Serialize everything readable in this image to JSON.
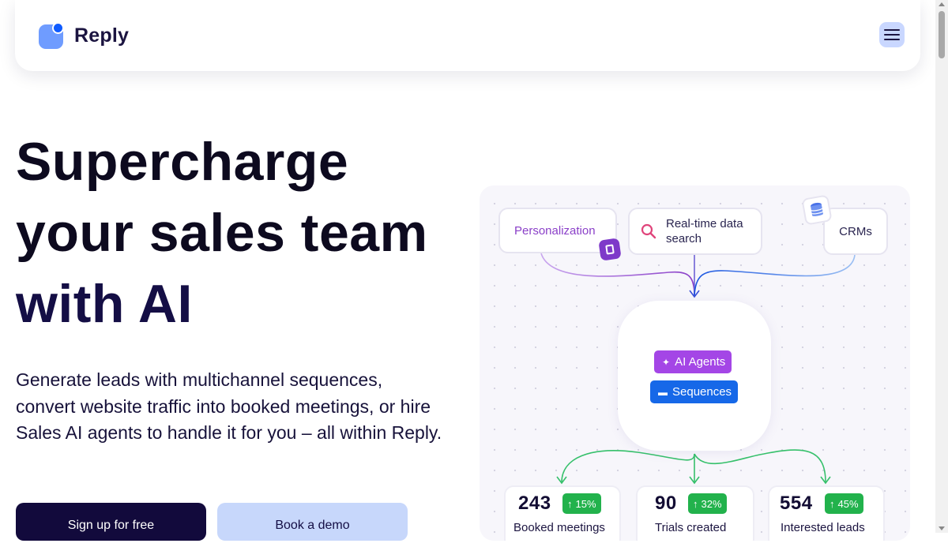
{
  "header": {
    "logo_text": "Reply",
    "menu_icon": "hamburger-menu-icon"
  },
  "hero": {
    "title_line1": "Supercharge",
    "title_line2": "your sales team",
    "title_line3": "with AI",
    "subtitle": "Generate leads with multichannel sequences, convert website traffic into booked meetings, or hire Sales AI agents to handle it for you – all within Reply.",
    "primary_button": "Sign up for free",
    "secondary_button": "Book a demo"
  },
  "illustration": {
    "inputs": [
      {
        "label": "Personalization"
      },
      {
        "label_line1": "Real-time data",
        "label_line2": "search"
      },
      {
        "label": "CRMs"
      }
    ],
    "core_tags": [
      {
        "label": "AI Agents",
        "icon": "sparkle-icon"
      },
      {
        "label": "Sequences",
        "icon": "stack-icon"
      }
    ],
    "stats": [
      {
        "value": "243",
        "change": "15%",
        "label": "Booked meetings"
      },
      {
        "value": "90",
        "change": "32%",
        "label": "Trials created"
      },
      {
        "value": "554",
        "change": "45%",
        "label": "Interested leads"
      }
    ]
  },
  "colors": {
    "brand_dark": "#120a3c",
    "brand_blue": "#1668e8",
    "accent_purple": "#a446e6",
    "success_green": "#22b24c",
    "button_light": "#c7d7fb"
  }
}
